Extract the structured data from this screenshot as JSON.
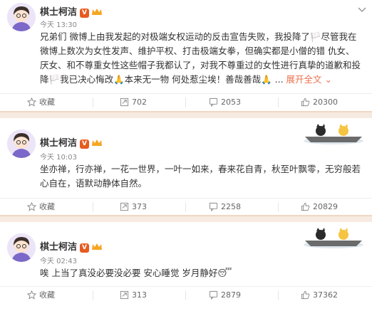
{
  "posts": [
    {
      "author": "棋士柯洁",
      "time": "今天 13:30",
      "text": "兄弟们 微博上由我发起的对极端女权运动的反击宣告失败，我投降了🏳️尽管我在微博上数次为女性发声、维护平权、打击极端女拳，但确实都是小僧的错 仇女、厌女、和不尊重女性这些帽子我都认了，对我不尊重过的女性进行真挚的道歉和投降🏳️我已决心悔改🙏本来无一物 何处惹尘埃！善哉善哉🙏 ...",
      "more": "展开全文 ⌄",
      "actions": {
        "favorite": "收藏",
        "repost": "702",
        "comment": "2053",
        "like": "20300"
      }
    },
    {
      "author": "棋士柯洁",
      "time": "今天 10:03",
      "text": "坐亦禅，行亦禅，一花一世界，一叶一如来，春来花自青，秋至叶飘零，无穷般若心自在，语默动静体自然。",
      "more": "",
      "actions": {
        "favorite": "收藏",
        "repost": "373",
        "comment": "2258",
        "like": "20829"
      }
    },
    {
      "author": "棋士柯洁",
      "time": "今天 02:43",
      "text": "唉 上当了真没必要没必要  安心睡觉 岁月静好😴",
      "more": "",
      "actions": {
        "favorite": "收藏",
        "repost": "313",
        "comment": "2879",
        "like": "37362"
      }
    }
  ],
  "icons": {
    "verified": "verified-v-icon",
    "vip": "vip-crown-icon",
    "menu": "chevron-down-icon",
    "favorite": "star-icon",
    "repost": "repost-icon",
    "comment": "comment-icon",
    "like": "thumb-up-icon",
    "decoration": "boat-cat-card-decoration"
  },
  "colors": {
    "accent": "#eb7350",
    "verified": "#e65c20",
    "separator": "#f7ebe1"
  }
}
